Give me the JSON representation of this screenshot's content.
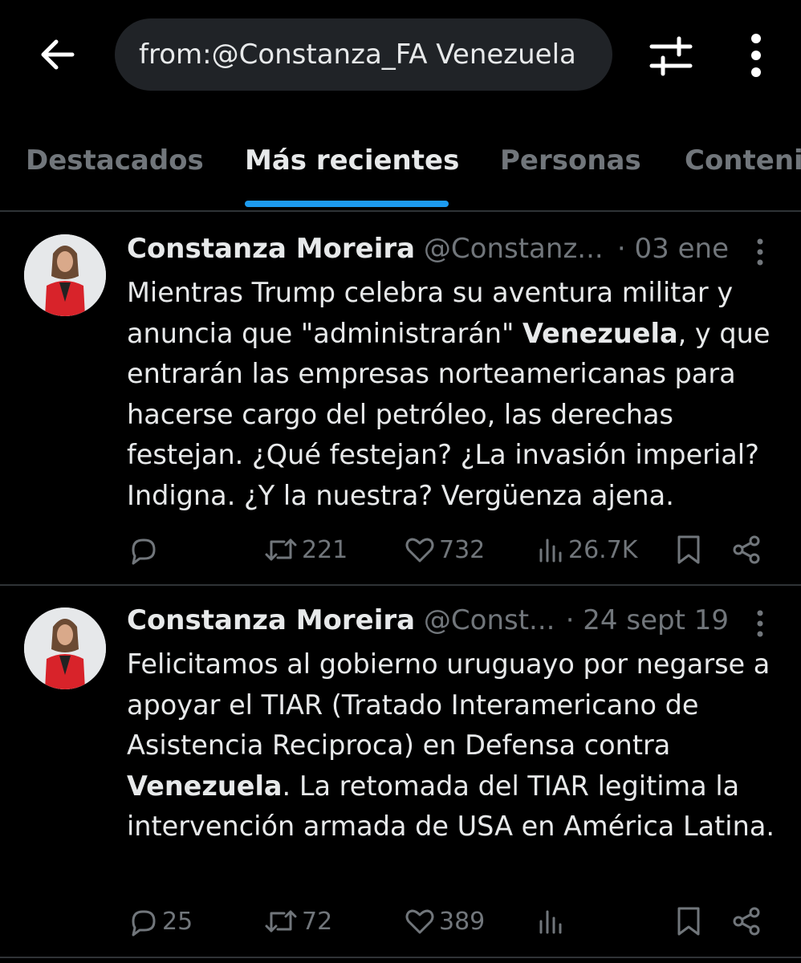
{
  "search": {
    "value": "from:@Constanza_FA Venezuela"
  },
  "tabs": [
    {
      "label": "Destacados"
    },
    {
      "label": "Más recientes"
    },
    {
      "label": "Personas"
    },
    {
      "label": "Contenido"
    }
  ],
  "active_tab": "Más recientes",
  "colors": {
    "accent": "#1d9bf0",
    "background": "#000000",
    "muted": "#71767b",
    "text": "#e7e9ea"
  },
  "tweets": [
    {
      "name": "Constanza Moreira",
      "handle": "@Constanz...",
      "date": "· 03 ene",
      "body": [
        {
          "text": "Mientras Trump celebra su aventura militar y anuncia que \"administrarán\" "
        },
        {
          "text": "Venezuela",
          "bold": true
        },
        {
          "text": ", y que entrarán las empresas norteamericanas para hacerse cargo del petróleo, las derechas festejan. ¿Qué festejan? ¿La invasión imperial? Indigna. ¿Y la nuestra?  Vergüenza ajena."
        }
      ],
      "stats": {
        "replies": "",
        "retweets": "221",
        "likes": "732",
        "views": "26.7K"
      }
    },
    {
      "name": "Constanza Moreira",
      "handle": "@Const...",
      "date": "· 24 sept 19",
      "body": [
        {
          "text": "Felicitamos al gobierno uruguayo por negarse a apoyar el TIAR (Tratado Interamericano de Asistencia Reciproca) en Defensa contra "
        },
        {
          "text": "Venezuela",
          "bold": true
        },
        {
          "text": ". La retomada del TIAR legitima la intervención armada de USA en América Latina."
        }
      ],
      "stats": {
        "replies": "25",
        "retweets": "72",
        "likes": "389",
        "views": ""
      }
    }
  ],
  "icons": [
    "back-arrow-icon",
    "filter-sliders-icon",
    "more-vertical-icon",
    "reply-icon",
    "retweet-icon",
    "like-icon",
    "views-icon",
    "bookmark-icon",
    "share-icon"
  ]
}
